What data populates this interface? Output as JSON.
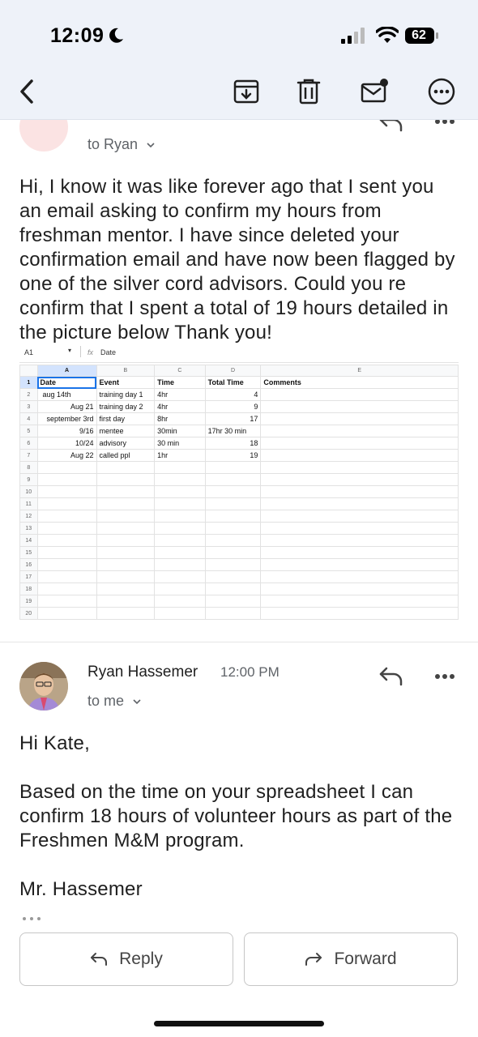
{
  "status_bar": {
    "time": "12:09",
    "battery": "62"
  },
  "toolbar": {
    "back_icon": "chevron-left-icon",
    "archive_icon": "archive-icon",
    "delete_icon": "trash-icon",
    "mark_unread_icon": "mail-unread-icon",
    "more_icon": "more-icon"
  },
  "first_message": {
    "to_line": "to Ryan",
    "body": "Hi, I know it was like forever ago that I sent you an email asking to confirm my hours from freshman mentor. I have since deleted your confirmation email and have now been flagged by one of the silver cord advisors. Could you re confirm that I spent a total of 19 hours detailed in the picture below Thank you!"
  },
  "spreadsheet": {
    "cell_ref": "A1",
    "formula_icon": "fx",
    "formula_value": "Date",
    "columns": [
      "A",
      "B",
      "C",
      "D",
      "E"
    ],
    "header_row": [
      "Date",
      "Event",
      "Time",
      "Total Time",
      "Comments"
    ],
    "rows": [
      [
        "aug 14th",
        "training day 1",
        "4hr",
        "4",
        ""
      ],
      [
        "Aug 21",
        "training day 2",
        "4hr",
        "9",
        ""
      ],
      [
        "september 3rd",
        "first day",
        "8hr",
        "17",
        ""
      ],
      [
        "9/16",
        "mentee",
        "30min",
        "17hr 30 min",
        ""
      ],
      [
        "10/24",
        "advisory",
        "30 min",
        "18",
        ""
      ],
      [
        "Aug 22",
        "called ppl",
        "1hr",
        "19",
        ""
      ]
    ],
    "row_numbers": [
      "1",
      "2",
      "3",
      "4",
      "5",
      "6",
      "7",
      "8",
      "9",
      "10",
      "11",
      "12",
      "13",
      "14",
      "15",
      "16",
      "17",
      "18",
      "19",
      "20"
    ]
  },
  "second_message": {
    "sender": "Ryan Hassemer",
    "time": "12:00 PM",
    "to_line": "to me",
    "body": "Hi Kate,\n\nBased on the time on your spreadsheet I can confirm 18 hours of volunteer hours as part of the Freshmen M&M program.\n\nMr. Hassemer"
  },
  "actions": {
    "reply": "Reply",
    "forward": "Forward"
  }
}
